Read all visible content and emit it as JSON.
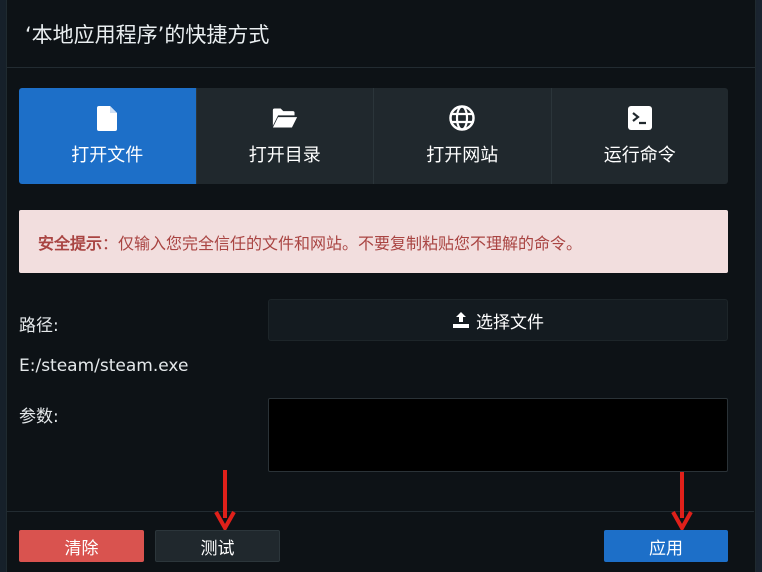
{
  "dialog": {
    "title": "‘本地应用程序’的快捷方式"
  },
  "tabs": [
    {
      "label": "打开文件",
      "icon": "file-icon",
      "active": true
    },
    {
      "label": "打开目录",
      "icon": "folder-open-icon",
      "active": false
    },
    {
      "label": "打开网站",
      "icon": "globe-icon",
      "active": false
    },
    {
      "label": "运行命令",
      "icon": "terminal-icon",
      "active": false
    }
  ],
  "alert": {
    "title": "安全提示",
    "message": "：仅输入您完全信任的文件和网站。不要复制粘贴您不理解的命令。"
  },
  "form": {
    "path_label": "路径:",
    "choose_file_label": "选择文件",
    "choose_file_icon": "upload-icon",
    "path_value": "E:/steam/steam.exe",
    "args_label": "参数:",
    "args_value": ""
  },
  "footer": {
    "clear_label": "清除",
    "test_label": "测试",
    "apply_label": "应用"
  },
  "colors": {
    "accent": "#1d6fc8",
    "danger": "#d9534f",
    "alert_bg": "#f2dede",
    "alert_text": "#a94442",
    "annotation_arrow": "#e0201a"
  }
}
